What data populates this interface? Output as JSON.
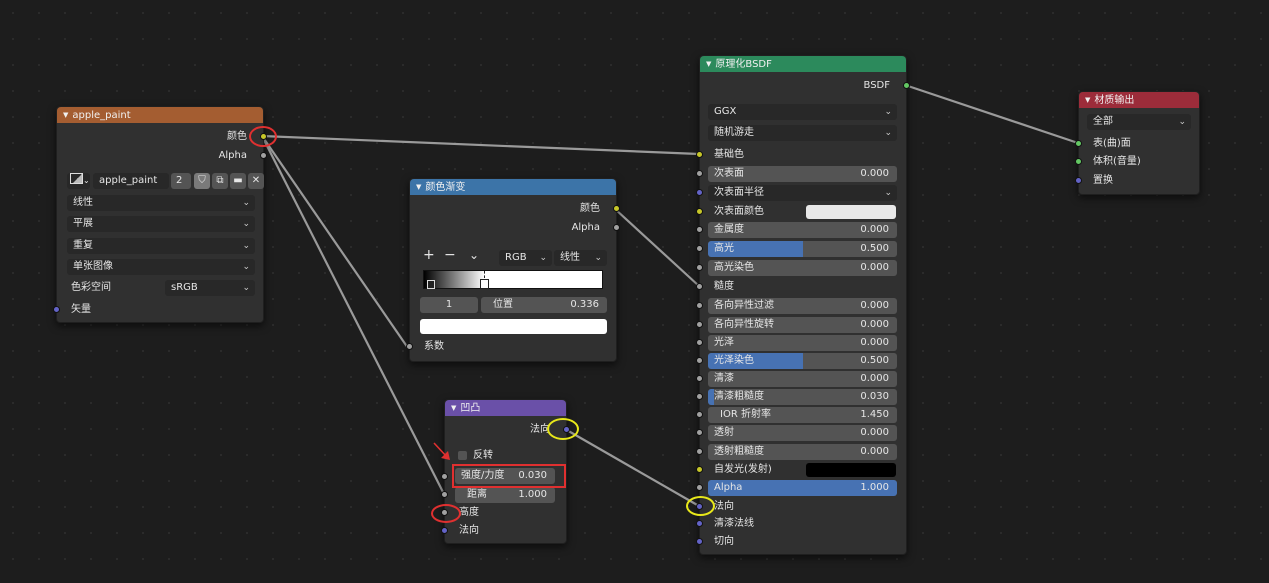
{
  "image_node": {
    "title": "apple_paint",
    "outputs": {
      "color": "颜色",
      "alpha": "Alpha"
    },
    "image_name": "apple_paint",
    "users": "2",
    "interpolation": "线性",
    "projection": "平展",
    "extension": "重复",
    "source": "单张图像",
    "colorspace_label": "色彩空间",
    "colorspace_value": "sRGB",
    "input_vector": "矢量",
    "header_color": "#a45d31"
  },
  "ramp_node": {
    "title": "颜色渐变",
    "outputs": {
      "color": "颜色",
      "alpha": "Alpha"
    },
    "add": "+",
    "remove": "−",
    "more": "⌄",
    "color_mode": "RGB",
    "interpolation": "线性",
    "stop_index": "1",
    "position_label": "位置",
    "position_value": "0.336",
    "input_fac": "系数",
    "header_color": "#3c74a8"
  },
  "bump_node": {
    "title": "凹凸",
    "output_normal": "法向",
    "invert": "反转",
    "strength_label": "强度/力度",
    "strength_value": "0.030",
    "distance_label": "距离",
    "distance_value": "1.000",
    "input_height": "高度",
    "input_normal": "法向",
    "header_color": "#6a50a8"
  },
  "bsdf_node": {
    "title": "原理化BSDF",
    "output": "BSDF",
    "distribution": "GGX",
    "subsurface_method": "随机游走",
    "base_color": "基础色",
    "subsurface": {
      "label": "次表面",
      "value": "0.000"
    },
    "subsurface_radius": "次表面半径",
    "subsurface_color": "次表面颜色",
    "metallic": {
      "label": "金属度",
      "value": "0.000"
    },
    "specular": {
      "label": "高光",
      "value": "0.500"
    },
    "specular_tint": {
      "label": "高光染色",
      "value": "0.000"
    },
    "roughness": "糙度",
    "anisotropic": {
      "label": "各向异性过滤",
      "value": "0.000"
    },
    "anisotropic_rotation": {
      "label": "各向异性旋转",
      "value": "0.000"
    },
    "sheen": {
      "label": "光泽",
      "value": "0.000"
    },
    "sheen_tint": {
      "label": "光泽染色",
      "value": "0.500"
    },
    "clearcoat": {
      "label": "清漆",
      "value": "0.000"
    },
    "clearcoat_roughness": {
      "label": "清漆粗糙度",
      "value": "0.030"
    },
    "ior": {
      "label": "IOR 折射率",
      "value": "1.450"
    },
    "transmission": {
      "label": "透射",
      "value": "0.000"
    },
    "transmission_roughness": {
      "label": "透射粗糙度",
      "value": "0.000"
    },
    "emission": "自发光(发射)",
    "alpha": {
      "label": "Alpha",
      "value": "1.000"
    },
    "normal": "法向",
    "clearcoat_normal": "清漆法线",
    "tangent": "切向",
    "header_color": "#2c8a5c"
  },
  "output_node": {
    "title": "材质输出",
    "target": "全部",
    "surface": "表(曲)面",
    "volume": "体积(音量)",
    "displacement": "置换",
    "header_color": "#9c2c3a"
  },
  "colors": {
    "socket_color": "#c7c729",
    "socket_float": "#a1a1a1",
    "socket_vector": "#6363c7",
    "socket_shader": "#63c763",
    "slider_fill": "#4772b3",
    "annotation_red": "#e03030",
    "annotation_yellow": "#e8e81a"
  }
}
